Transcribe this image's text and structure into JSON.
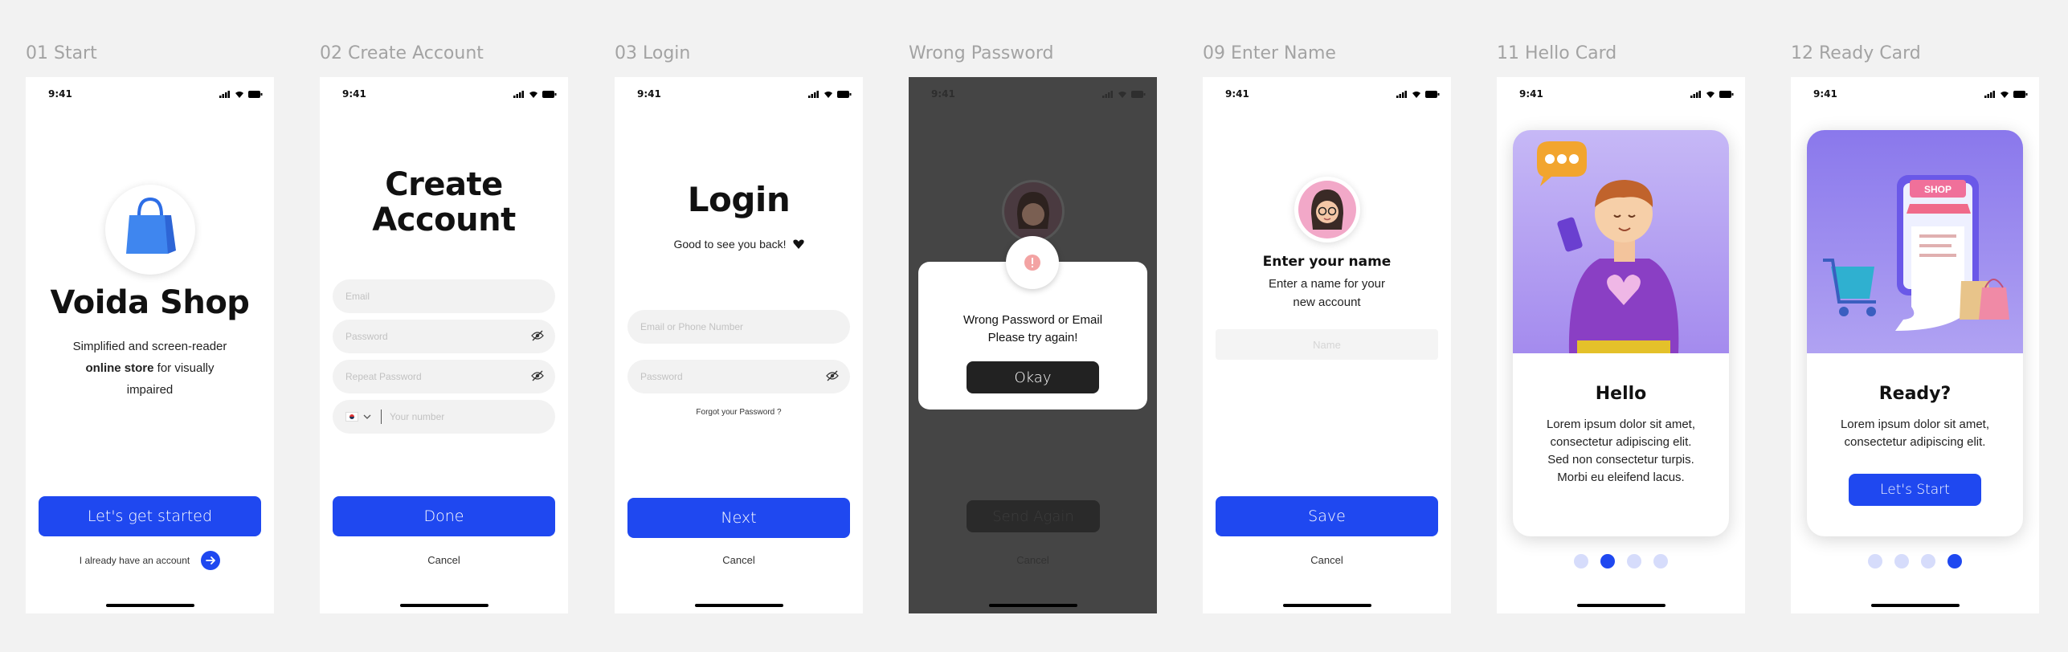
{
  "colors": {
    "primary": "#1f48f0",
    "overlay": "#454545",
    "page_bg": "#f2f2f2"
  },
  "status_time": "9:41",
  "screens": {
    "start": {
      "label": "01 Start",
      "title": "Voida Shop",
      "desc_1": "Simplified and screen-reader",
      "desc_bold": "online store",
      "desc_2": " for visually",
      "desc_3": "impaired",
      "cta": "Let's get started",
      "already": "I already have an account"
    },
    "create": {
      "label": "02 Create Account",
      "title_1": "Create",
      "title_2": "Account",
      "email_placeholder": "Email",
      "password_placeholder": "Password",
      "repeat_placeholder": "Repeat Password",
      "phone_placeholder": "Your number",
      "done": "Done",
      "cancel": "Cancel"
    },
    "login": {
      "label": "03 Login",
      "title": "Login",
      "subtitle": "Good to see you back!",
      "email_placeholder": "Email or Phone Number",
      "password_placeholder": "Password",
      "forgot": "Forgot your Password ?",
      "next": "Next",
      "cancel": "Cancel"
    },
    "wrong": {
      "label": "Wrong Password",
      "message_1": "Wrong Password or Email",
      "message_2": "Please try again!",
      "okay": "Okay",
      "send_again": "Send Again",
      "cancel": "Cancel"
    },
    "name": {
      "label": "09 Enter Name",
      "title": "Enter your name",
      "subtitle_1": "Enter a name for your",
      "subtitle_2": "new account",
      "name_placeholder": "Name",
      "save": "Save",
      "cancel": "Cancel"
    },
    "hello": {
      "label": "11 Hello Card",
      "title": "Hello",
      "text_1": "Lorem ipsum dolor sit amet,",
      "text_2": "consectetur adipiscing elit.",
      "text_3": "Sed non consectetur turpis.",
      "text_4": "Morbi eu eleifend lacus.",
      "active_dot": 2
    },
    "ready": {
      "label": "12 Ready Card",
      "title": "Ready?",
      "text_1": "Lorem ipsum dolor sit amet,",
      "text_2": "consectetur adipiscing elit.",
      "cta": "Let's Start",
      "shop_sign": "SHOP",
      "active_dot": 4
    }
  }
}
